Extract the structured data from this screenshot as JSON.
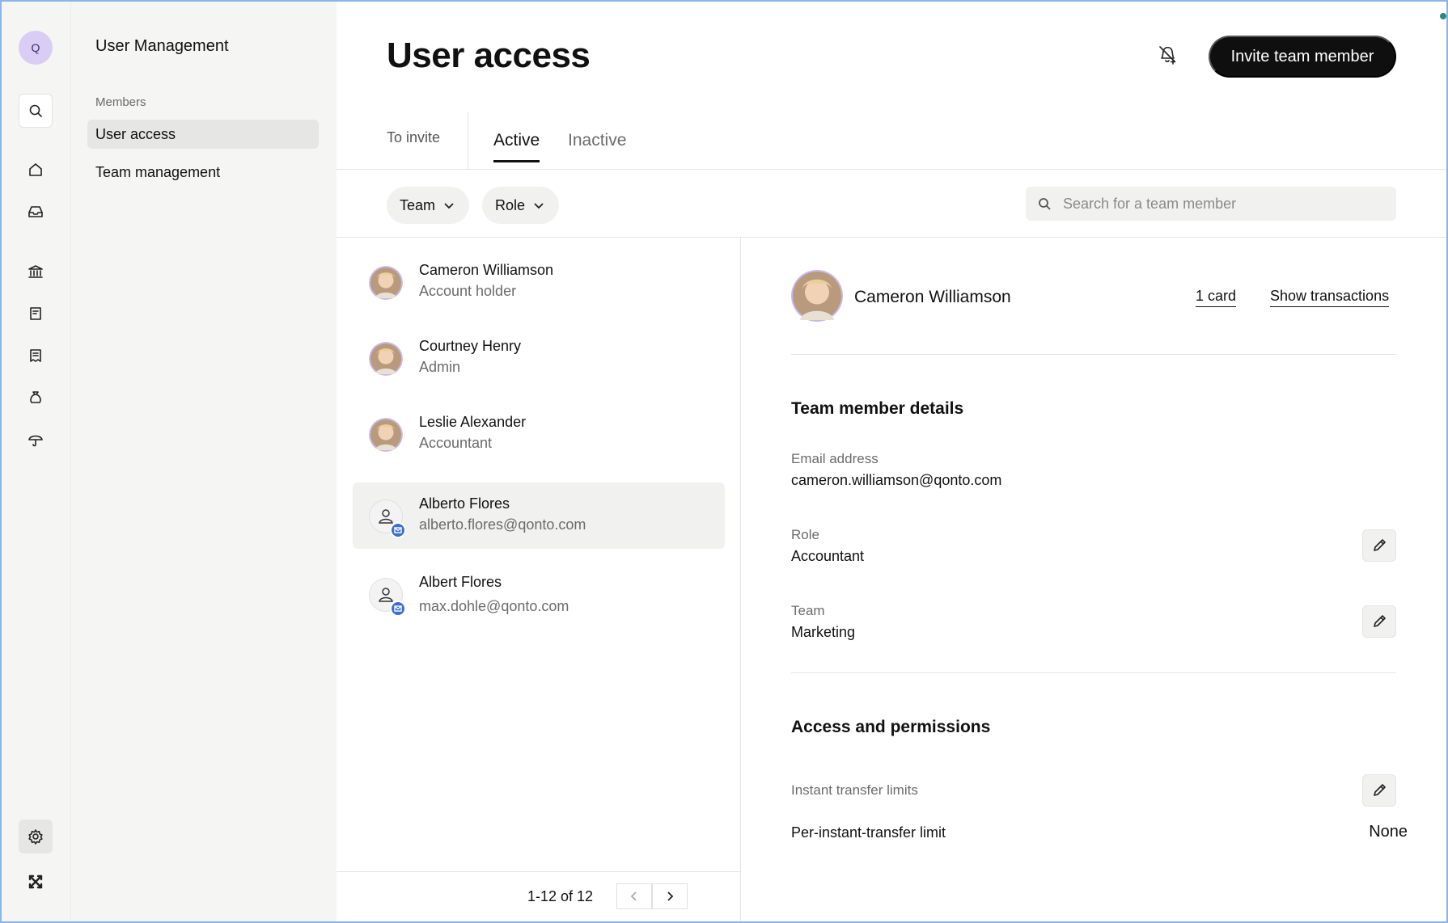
{
  "rail": {
    "avatar_initial": "Q",
    "icons": [
      "search-icon",
      "home-icon",
      "inbox-icon",
      "bank-icon",
      "document-icon",
      "receipt-icon",
      "money-bag-icon",
      "umbrella-icon",
      "settings-icon",
      "brand-logo-icon"
    ]
  },
  "subnav": {
    "title": "User Management",
    "section_label": "Members",
    "items": [
      {
        "label": "User access",
        "active": true
      },
      {
        "label": "Team management",
        "active": false
      }
    ]
  },
  "header": {
    "title": "User access",
    "invite_button": "Invite team member"
  },
  "tabs": {
    "to_invite": "To invite",
    "active": "Active",
    "inactive": "Inactive"
  },
  "filters": {
    "team": "Team",
    "role": "Role",
    "search_placeholder": "Search for a team member"
  },
  "members": [
    {
      "name": "Cameron Williamson",
      "subtitle": "Account holder",
      "avatar": "photo"
    },
    {
      "name": "Courtney Henry",
      "subtitle": "Admin",
      "avatar": "photo"
    },
    {
      "name": "Leslie Alexander",
      "subtitle": "Accountant",
      "avatar": "photo"
    },
    {
      "name": "Alberto Flores",
      "subtitle": "alberto.flores@qonto.com",
      "avatar": "pending-invite"
    },
    {
      "name": "Albert Flores",
      "subtitle": "max.dohle@qonto.com",
      "avatar": "pending-invite"
    }
  ],
  "pagination": {
    "label": "1-12 of 12"
  },
  "detail": {
    "name": "Cameron Williamson",
    "cards_link": "1 card",
    "transactions_link": "Show transactions",
    "details_heading": "Team member details",
    "email_label": "Email address",
    "email_value": "cameron.williamson@qonto.com",
    "role_label": "Role",
    "role_value": "Accountant",
    "team_label": "Team",
    "team_value": "Marketing",
    "permissions_heading": "Access and permissions",
    "instant_limits_label": "Instant transfer limits",
    "per_transfer_label": "Per-instant-transfer limit",
    "per_transfer_value": "None"
  },
  "colors": {
    "accent_dark": "#0f0f0f",
    "avatar_ring": "#c9b8e8",
    "mail_badge": "#3d6fcf"
  }
}
